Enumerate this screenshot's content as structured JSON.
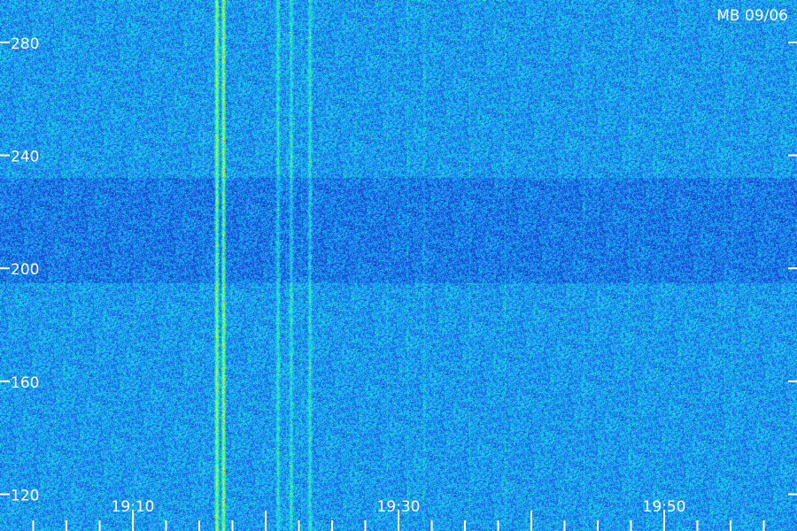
{
  "chart_data": {
    "type": "heatmap",
    "title": "MB 09/06",
    "y_tick_labels": [
      "280",
      "240",
      "200",
      "160",
      "120"
    ],
    "y_ticks": [
      280,
      240,
      200,
      160,
      120
    ],
    "x_tick_labels": [
      "19:10",
      "19:30",
      "19:50"
    ],
    "y_range": [
      107,
      295
    ],
    "x_range_minutes": [
      1140,
      1200
    ],
    "x_tick_minutes": [
      1150,
      1170,
      1190
    ],
    "colormap": [
      "#000033",
      "#0a1ea0",
      "#1e64e6",
      "#19c8ff",
      "#32ff96",
      "#e6ff32",
      "#ff7814"
    ],
    "bright_bands_minutes": [
      1156.3,
      1156.8,
      1160.9,
      1161.9,
      1163.3
    ]
  }
}
